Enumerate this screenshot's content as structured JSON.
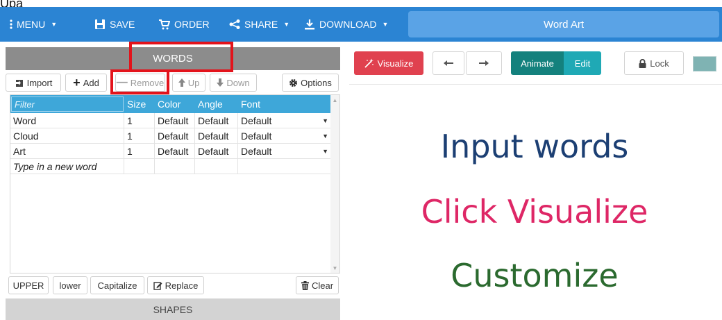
{
  "top_fragment": "Upa",
  "navbar": {
    "menu": "MENU",
    "save": "SAVE",
    "order": "ORDER",
    "share": "SHARE",
    "download": "DOWNLOAD",
    "title": "Word Art"
  },
  "words_panel": {
    "header": "WORDS",
    "toolbar": {
      "import": "Import",
      "add": "Add",
      "remove": "Remove",
      "up": "Up",
      "down": "Down",
      "options": "Options"
    },
    "columns": {
      "filter": "Filter",
      "size": "Size",
      "color": "Color",
      "angle": "Angle",
      "font": "Font"
    },
    "rows": [
      {
        "word": "Word",
        "size": "1",
        "color": "Default",
        "angle": "Default",
        "font": "Default"
      },
      {
        "word": "Cloud",
        "size": "1",
        "color": "Default",
        "angle": "Default",
        "font": "Default"
      },
      {
        "word": "Art",
        "size": "1",
        "color": "Default",
        "angle": "Default",
        "font": "Default"
      }
    ],
    "new_word_placeholder": "Type in a new word",
    "bottom": {
      "upper": "UPPER",
      "lower": "lower",
      "capitalize": "Capitalize",
      "replace": "Replace",
      "clear": "Clear"
    }
  },
  "shapes_header": "SHAPES",
  "canvas_toolbar": {
    "visualize": "Visualize",
    "animate": "Animate",
    "edit": "Edit",
    "lock": "Lock",
    "swatch_color": "#7fb3b3"
  },
  "canvas": {
    "line1": "Input words",
    "line2": "Click Visualize",
    "line3": "Customize",
    "colors": {
      "line1": "#1c3f73",
      "line2": "#de2766",
      "line3": "#2b6a2f"
    }
  },
  "theme": {
    "navbar": "#2b84d3",
    "highlight": "#e3131b",
    "grid_header": "#3ea7d9"
  }
}
